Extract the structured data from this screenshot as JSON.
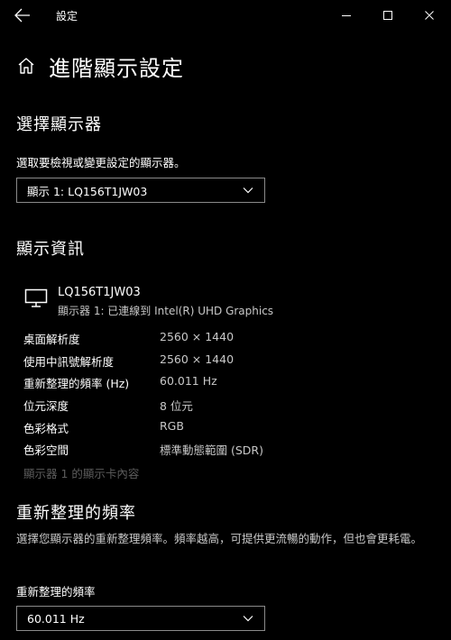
{
  "window": {
    "title": "設定"
  },
  "page": {
    "title": "進階顯示設定"
  },
  "choose_display": {
    "heading": "選擇顯示器",
    "prompt": "選取要檢視或變更設定的顯示器。",
    "selected": "顯示 1: LQ156T1JW03"
  },
  "display_info": {
    "heading": "顯示資訊",
    "monitor_name": "LQ156T1JW03",
    "monitor_sub": "顯示器 1: 已連線到 Intel(R) UHD Graphics",
    "rows": [
      {
        "key": "桌面解析度",
        "value": "2560 × 1440"
      },
      {
        "key": "使用中訊號解析度",
        "value": "2560 × 1440"
      },
      {
        "key": "重新整理的頻率 (Hz)",
        "value": "60.011 Hz"
      },
      {
        "key": "位元深度",
        "value": "8 位元"
      },
      {
        "key": "色彩格式",
        "value": "RGB"
      },
      {
        "key": "色彩空間",
        "value": "標準動態範圍 (SDR)"
      }
    ],
    "adapter_link": "顯示器 1 的顯示卡內容"
  },
  "refresh": {
    "heading": "重新整理的頻率",
    "description": "選擇您顯示器的重新整理頻率。頻率越高，可提供更流暢的動作，但也會更耗電。",
    "label": "重新整理的頻率",
    "selected": "60.011 Hz"
  },
  "icons": {
    "back": "back-arrow-icon",
    "minimize": "minimize-icon",
    "maximize": "maximize-icon",
    "close": "close-icon",
    "home": "home-icon",
    "monitor": "monitor-icon",
    "chevron": "chevron-down-icon"
  },
  "colors": {
    "background": "#000000",
    "text": "#ffffff",
    "secondary_text": "#c8c8c8",
    "disabled_text": "#5c5c5c",
    "border": "#8a8a8a"
  }
}
